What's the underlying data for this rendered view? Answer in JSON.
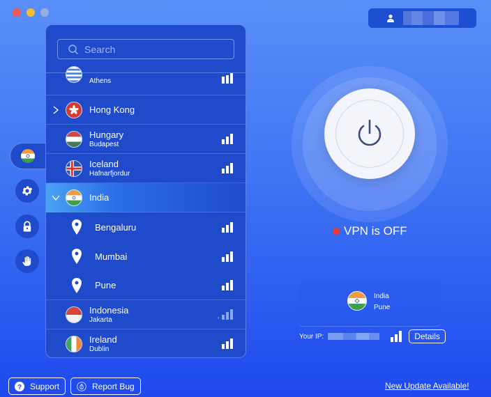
{
  "window": {
    "controls": [
      "close",
      "minimize",
      "zoom"
    ]
  },
  "account": {
    "icon": "user-icon",
    "username_redacted": true
  },
  "side_nav": {
    "items": [
      {
        "name": "locations",
        "icon": "india-flag-icon",
        "active": true
      },
      {
        "name": "settings",
        "icon": "gear-icon"
      },
      {
        "name": "security",
        "icon": "lock-icon"
      },
      {
        "name": "block",
        "icon": "hand-icon"
      }
    ]
  },
  "search": {
    "placeholder": "Search",
    "value": ""
  },
  "locations": [
    {
      "country": "",
      "city": "Athens",
      "flag": "greece",
      "signal": "strong",
      "partial": true
    },
    {
      "country": "Hong Kong",
      "city": "",
      "flag": "hongkong",
      "expandable": true,
      "expanded": false
    },
    {
      "country": "Hungary",
      "city": "Budapest",
      "flag": "hungary",
      "signal": "strong"
    },
    {
      "country": "Iceland",
      "city": "Hafnarfjordur",
      "flag": "iceland",
      "signal": "strong"
    },
    {
      "country": "India",
      "city": "",
      "flag": "india",
      "expandable": true,
      "expanded": true,
      "selected": true,
      "children": [
        {
          "city": "Bengaluru",
          "signal": "strong"
        },
        {
          "city": "Mumbai",
          "signal": "strong"
        },
        {
          "city": "Pune",
          "signal": "strong"
        }
      ]
    },
    {
      "country": "Indonesia",
      "city": "Jakarta",
      "flag": "indonesia",
      "signal": "unavailable"
    },
    {
      "country": "Ireland",
      "city": "Dublin",
      "flag": "ireland",
      "signal": "strong"
    }
  ],
  "connection": {
    "status_text": "VPN is OFF",
    "status_color": "#ee3a2c",
    "country": "India",
    "city": "Pune",
    "ip_label": "Your IP:",
    "ip_redacted": true,
    "details_label": "Details"
  },
  "footer": {
    "support_label": "Support",
    "report_bug_label": "Report Bug",
    "update_link": "New Update Available!"
  }
}
